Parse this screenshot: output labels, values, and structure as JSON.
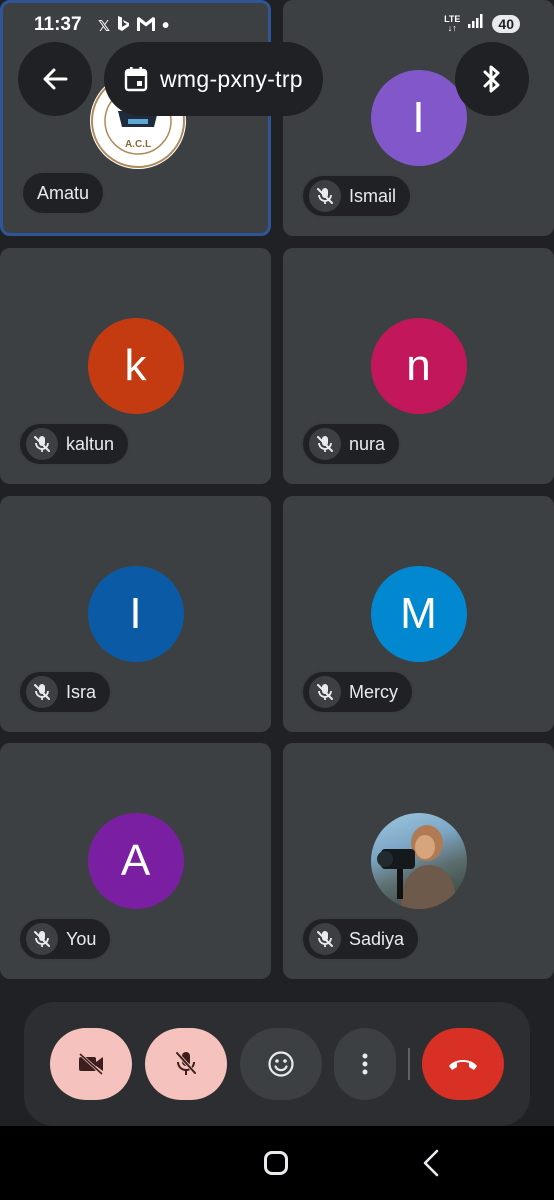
{
  "status_bar": {
    "time": "11:37",
    "left_icons": [
      "x-app-icon",
      "bing-icon",
      "gmail-icon",
      "dot-icon"
    ],
    "network": "LTE",
    "battery": "40"
  },
  "top_bar": {
    "back_icon": "arrow-left-icon",
    "calendar_icon": "calendar-icon",
    "meeting_code": "wmg-pxny-trp",
    "bluetooth_icon": "bluetooth-icon"
  },
  "participants": [
    {
      "name": "Amatu",
      "initial": "",
      "avatar_type": "logo",
      "muted": false,
      "active": true,
      "logo_text": "A.C.L"
    },
    {
      "name": "Ismail",
      "initial": "I",
      "avatar_type": "letter",
      "color": "#8257c9",
      "muted": true,
      "active": false
    },
    {
      "name": "kaltun",
      "initial": "k",
      "avatar_type": "letter",
      "color": "#c53b11",
      "muted": true,
      "active": false
    },
    {
      "name": "nura",
      "initial": "n",
      "avatar_type": "letter",
      "color": "#c2185b",
      "muted": true,
      "active": false
    },
    {
      "name": "Isra",
      "initial": "I",
      "avatar_type": "letter",
      "color": "#0b5aa6",
      "muted": true,
      "active": false
    },
    {
      "name": "Mercy",
      "initial": "M",
      "avatar_type": "letter",
      "color": "#0288d1",
      "muted": true,
      "active": false
    },
    {
      "name": "You",
      "initial": "A",
      "avatar_type": "letter",
      "color": "#7b1fa2",
      "muted": true,
      "active": false
    },
    {
      "name": "Sadiya",
      "initial": "",
      "avatar_type": "photo",
      "muted": true,
      "active": false
    }
  ],
  "controls": {
    "camera_icon": "camera-off-icon",
    "mic_icon": "mic-off-icon",
    "reactions_icon": "emoji-icon",
    "more_icon": "more-vert-icon",
    "end_call_icon": "end-call-icon"
  },
  "nav": {
    "home_icon": "home-icon",
    "back_icon": "back-icon"
  },
  "colors": {
    "background": "#202124",
    "tile": "#3c4043",
    "active_border": "#2f5597",
    "control_pink": "#f6c2be",
    "end_call_red": "#d93025"
  }
}
